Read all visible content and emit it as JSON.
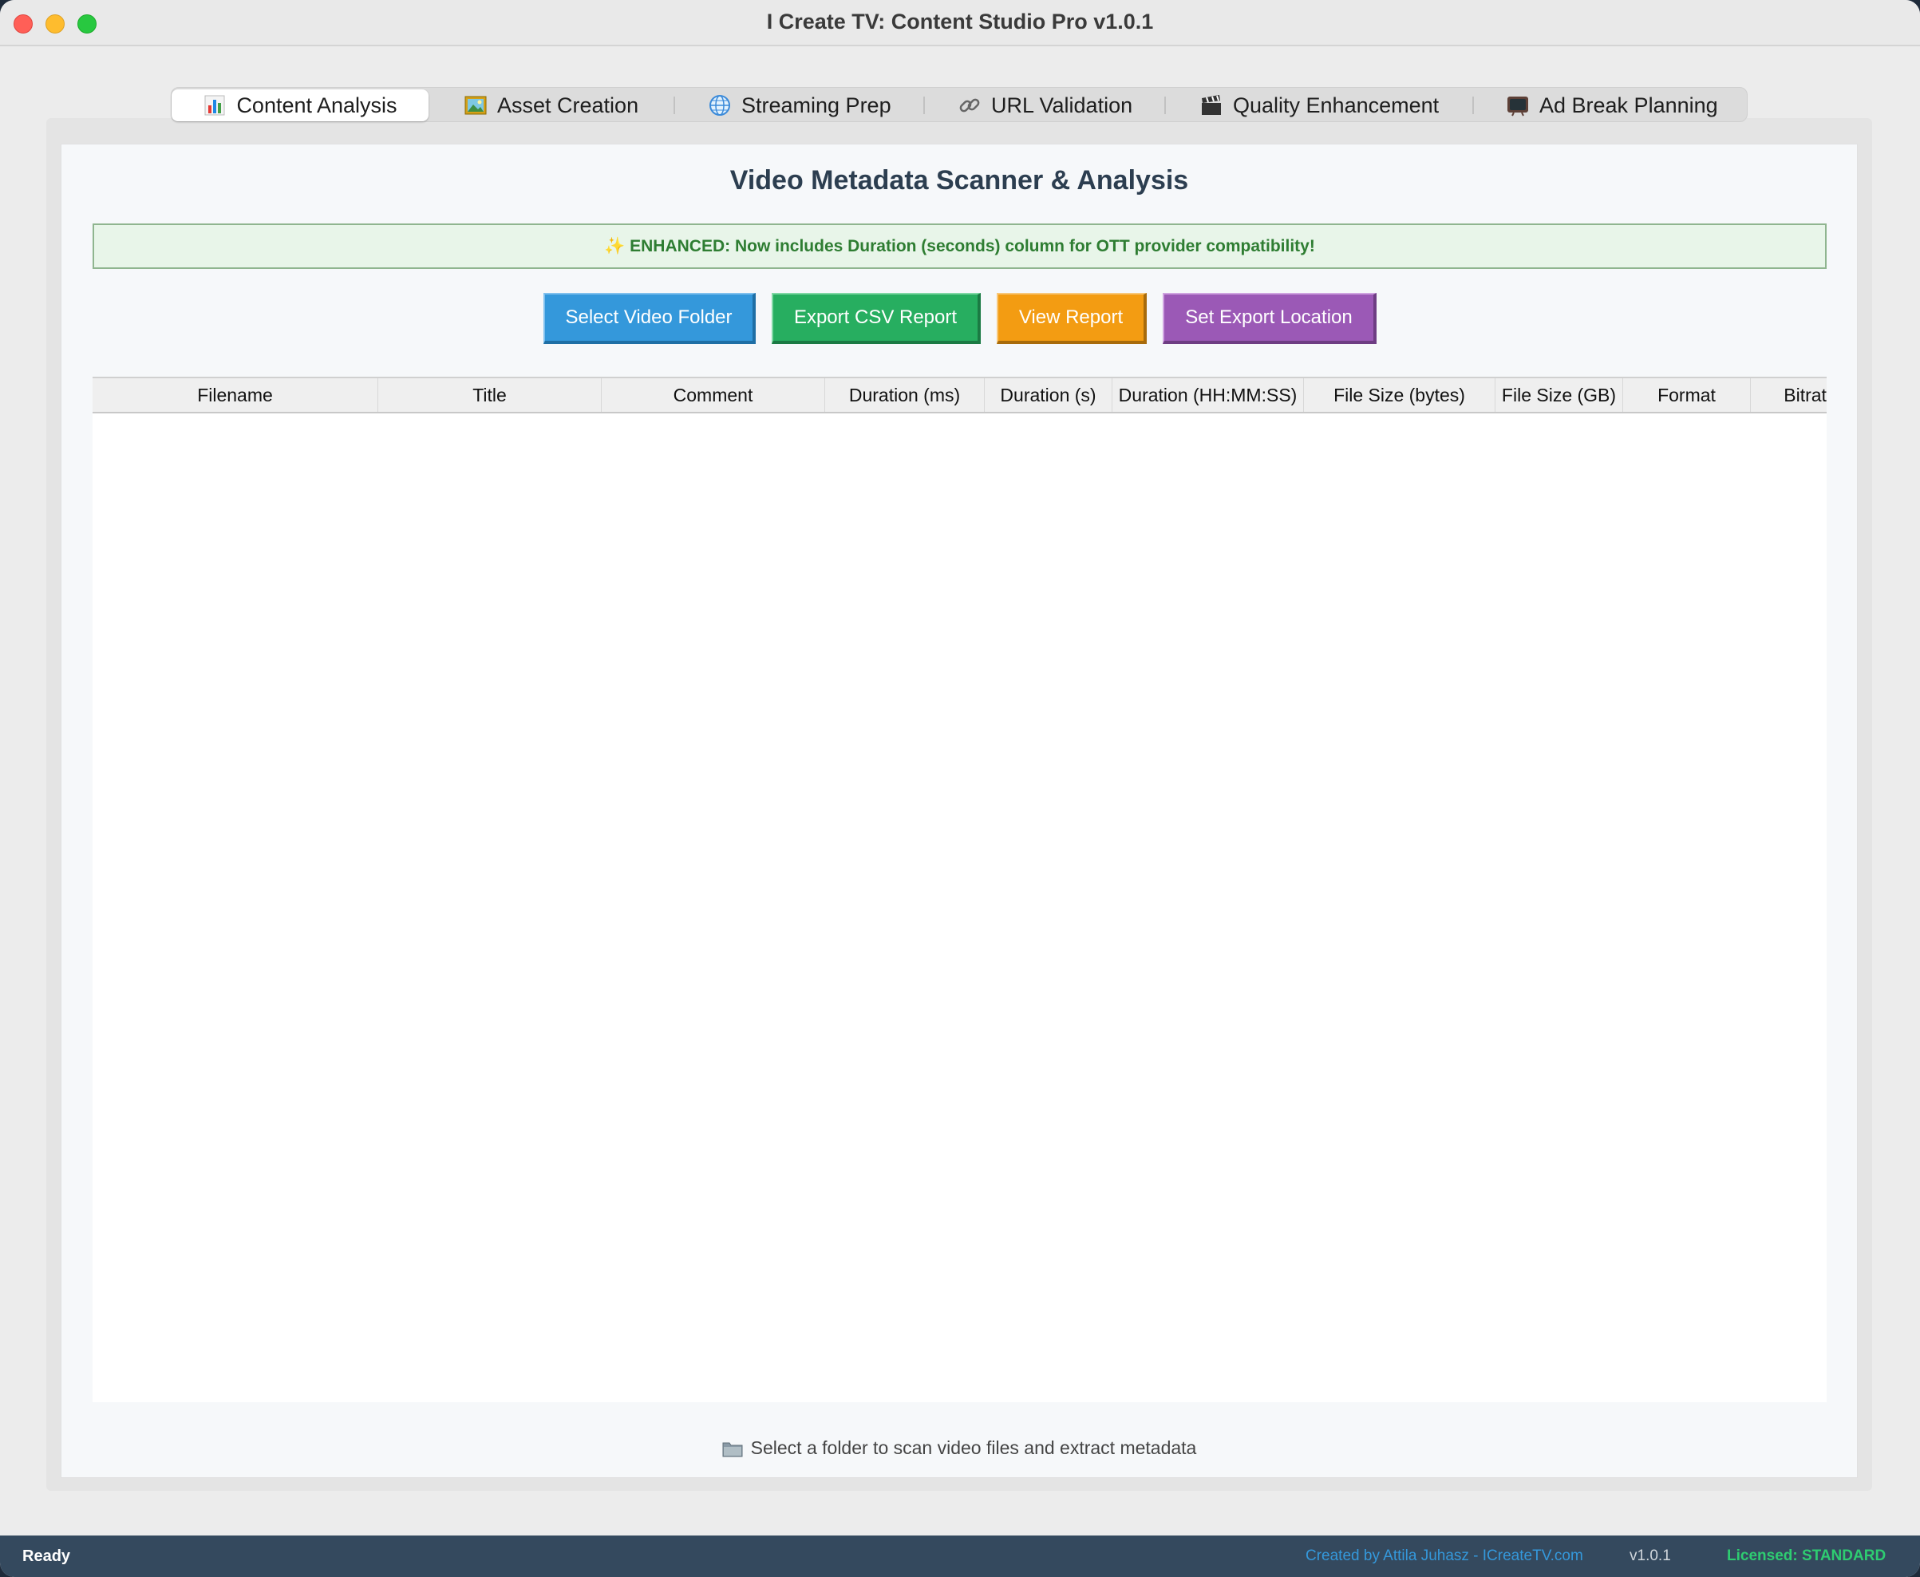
{
  "window": {
    "title": "I Create TV: Content Studio Pro v1.0.1"
  },
  "tabs": [
    {
      "label": "Content Analysis",
      "icon": "bar-chart-icon"
    },
    {
      "label": "Asset Creation",
      "icon": "picture-icon"
    },
    {
      "label": "Streaming Prep",
      "icon": "globe-icon"
    },
    {
      "label": "URL Validation",
      "icon": "link-icon"
    },
    {
      "label": "Quality Enhancement",
      "icon": "clapper-icon"
    },
    {
      "label": "Ad Break Planning",
      "icon": "tv-icon"
    }
  ],
  "active_tab": "Content Analysis",
  "main": {
    "title": "Video Metadata Scanner & Analysis",
    "banner": "✨ ENHANCED: Now includes Duration (seconds) column for OTT provider compatibility!",
    "buttons": {
      "select_folder": "Select Video Folder",
      "export_csv": "Export CSV Report",
      "view_report": "View Report",
      "set_export": "Set Export Location"
    },
    "columns": [
      "Filename",
      "Title",
      "Comment",
      "Duration (ms)",
      "Duration (s)",
      "Duration (HH:MM:SS)",
      "File Size (bytes)",
      "File Size (GB)",
      "Format",
      "Bitrate"
    ],
    "hint": "Select a folder to scan video files and extract metadata"
  },
  "status": {
    "state": "Ready",
    "credit": "Created by Attila Juhasz - ICreateTV.com",
    "version": "v1.0.1",
    "license": "Licensed: STANDARD"
  },
  "colors": {
    "blue": "#3498db",
    "green": "#27ae60",
    "orange": "#f39c12",
    "purple": "#9b59b6",
    "statusbar": "#34495e",
    "title": "#2c3e50"
  }
}
